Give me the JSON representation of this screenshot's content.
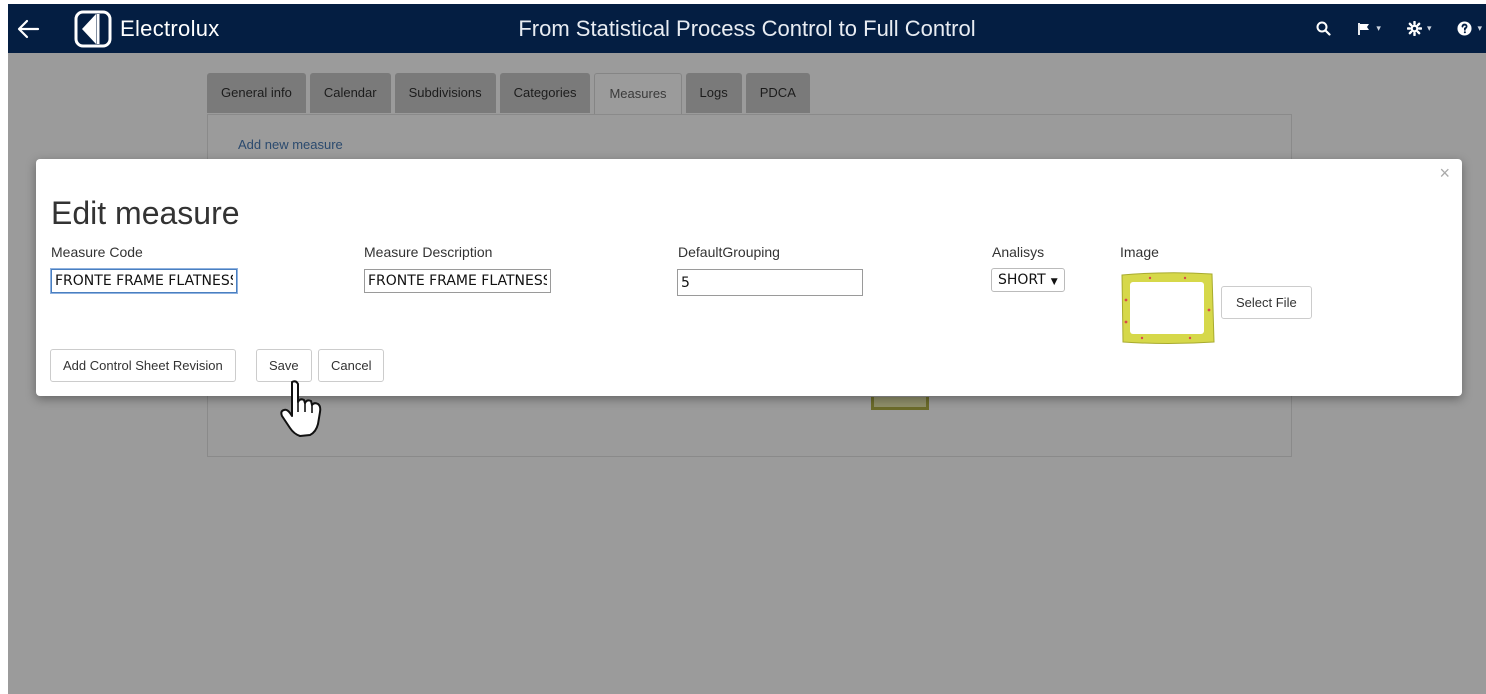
{
  "navbar": {
    "brand": "Electrolux",
    "title": "From Statistical Process Control to Full Control",
    "icons": [
      "back-arrow-icon",
      "electrolux-logo-icon",
      "search-icon",
      "flag-icon",
      "gear-icon",
      "help-icon"
    ],
    "caret": "▾"
  },
  "tabs": [
    {
      "label": "General info"
    },
    {
      "label": "Calendar"
    },
    {
      "label": "Subdivisions"
    },
    {
      "label": "Categories"
    },
    {
      "label": "Measures"
    },
    {
      "label": "Logs"
    },
    {
      "label": "PDCA"
    }
  ],
  "panel": {
    "add_link": "Add new measure"
  },
  "modal": {
    "title": "Edit measure",
    "close": "×",
    "fields": {
      "measure_code": {
        "label": "Measure Code",
        "value": "FRONTE FRAME FLATNESS"
      },
      "measure_description": {
        "label": "Measure Description",
        "value": "FRONTE FRAME FLATNESS"
      },
      "default_grouping": {
        "label": "DefaultGrouping",
        "value": "5"
      },
      "analisys": {
        "label": "Analisys",
        "selected": "SHORT",
        "arrow": "▼"
      },
      "image": {
        "label": "Image"
      }
    },
    "select_file": "Select File",
    "buttons": {
      "add_revision": "Add Control Sheet Revision",
      "save": "Save",
      "cancel": "Cancel"
    }
  },
  "colors": {
    "navbar": "#041e42",
    "overlay": "#9b9b9b",
    "focus": "#4a7fc0",
    "frame_yellow": "#d6d84a"
  }
}
